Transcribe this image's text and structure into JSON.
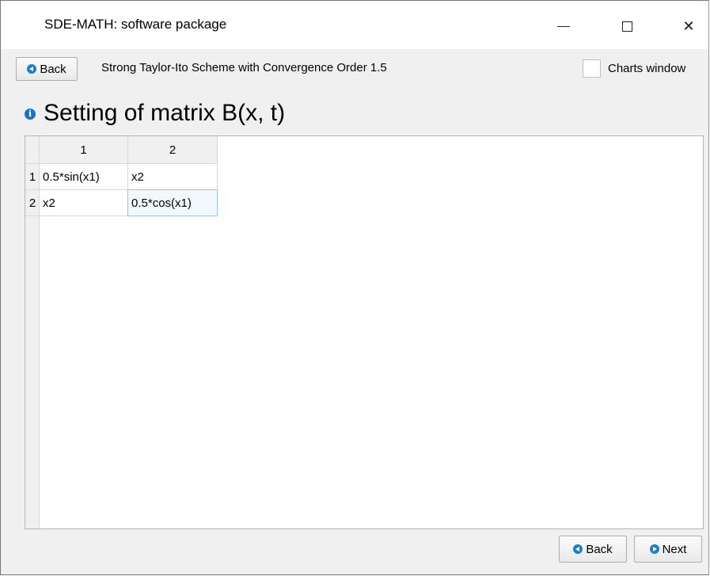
{
  "window": {
    "title": "SDE-MATH: software package",
    "controls": [
      "minimize",
      "maximize",
      "close"
    ]
  },
  "toolbar": {
    "back_label": "Back",
    "scheme_title": "Strong Taylor-Ito Scheme with Convergence Order 1.5",
    "charts_window_label": "Charts window",
    "charts_window_checked": false
  },
  "heading": {
    "text": "Setting of matrix B(x, t)",
    "icon": "info-icon"
  },
  "grid": {
    "column_headers": [
      "1",
      "2"
    ],
    "row_headers": [
      "1",
      "2"
    ],
    "cells": [
      [
        "0.5*sin(x1)",
        "x2"
      ],
      [
        "x2",
        "0.5*cos(x1)"
      ]
    ],
    "selected_cell": "row 2, column 2"
  },
  "footer": {
    "back_label": "Back",
    "next_label": "Next"
  },
  "colors": {
    "accent": "#1d7fc4",
    "window_bg": "#f0f0f0",
    "selection_border": "#9fc3e6"
  }
}
